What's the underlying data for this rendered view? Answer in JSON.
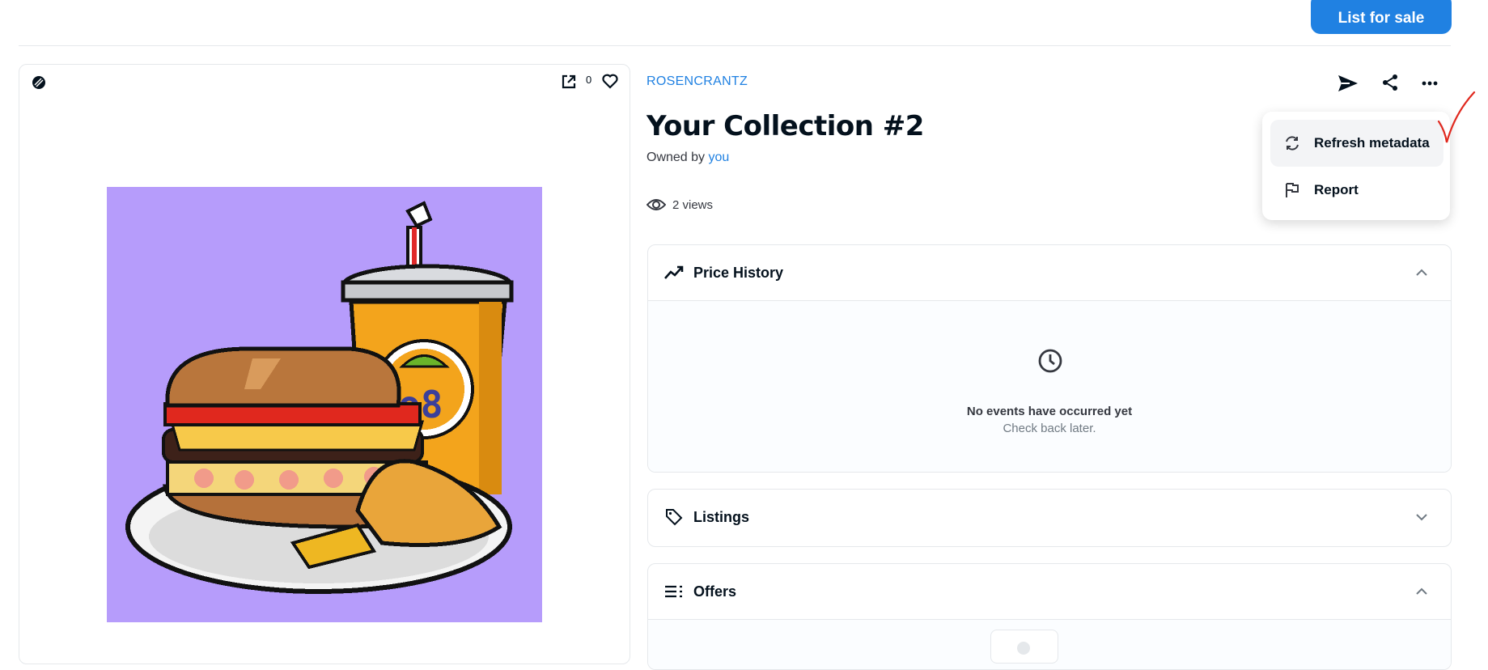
{
  "header": {
    "list_for_sale": "List for sale"
  },
  "artwork": {
    "favorite_count": "0"
  },
  "item": {
    "collection": "ROSENCRANTZ",
    "title": "Your Collection #2",
    "owned_by_prefix": "Owned by",
    "owner": "you",
    "views": "2 views"
  },
  "menu": {
    "items": [
      {
        "label": "Refresh metadata",
        "icon": "refresh-icon"
      },
      {
        "label": "Report",
        "icon": "flag-icon"
      }
    ]
  },
  "panels": {
    "price_history": {
      "label": "Price History",
      "empty_title": "No events have occurred yet",
      "empty_sub": "Check back later."
    },
    "listings": {
      "label": "Listings"
    },
    "offers": {
      "label": "Offers"
    }
  },
  "colors": {
    "accent": "#2081e2",
    "artwork_bg": "#b69cfb",
    "annotation": "#e0281e"
  }
}
